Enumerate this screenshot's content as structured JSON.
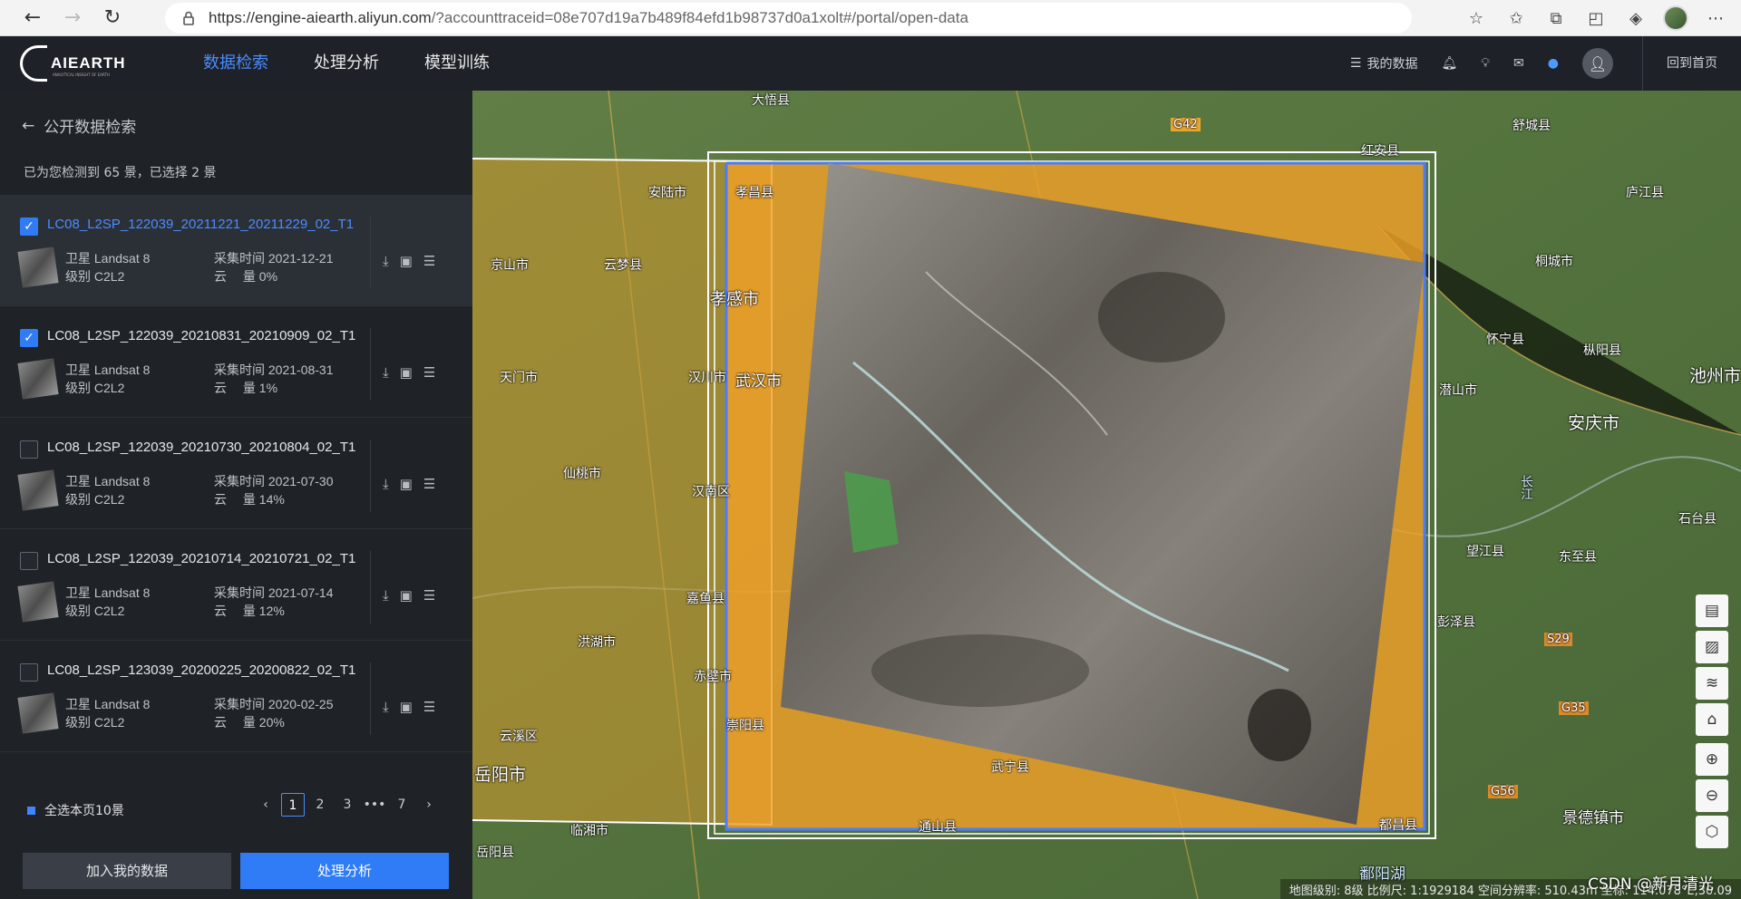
{
  "browser": {
    "url_main": "https://engine-aiearth.aliyun.com",
    "url_rest": "/?accounttraceid=08e707d19a7b489f84efd1b98737d0a1xolt#/portal/open-data"
  },
  "header": {
    "logo_text": "AIEARTH",
    "logo_sub": "ANALYTICAL INSIGHT OF EARTH",
    "nav": [
      "数据检索",
      "处理分析",
      "模型训练"
    ],
    "my_data": "我的数据",
    "back_home": "回到首页"
  },
  "sidebar": {
    "title": "公开数据检索",
    "count_text": "已为您检测到 65 景，已选择 2 景",
    "items": [
      {
        "name": "LC08_L2SP_122039_20211221_20211229_02_T1",
        "sat": "卫星 Landsat 8",
        "level": "级别 C2L2",
        "time": "采集时间 2021-12-21",
        "cloud": "云　 量 0%",
        "checked": true
      },
      {
        "name": "LC08_L2SP_122039_20210831_20210909_02_T1",
        "sat": "卫星 Landsat 8",
        "level": "级别 C2L2",
        "time": "采集时间 2021-08-31",
        "cloud": "云　 量 1%",
        "checked": true
      },
      {
        "name": "LC08_L2SP_122039_20210730_20210804_02_T1",
        "sat": "卫星 Landsat 8",
        "level": "级别 C2L2",
        "time": "采集时间 2021-07-30",
        "cloud": "云　 量 14%",
        "checked": false
      },
      {
        "name": "LC08_L2SP_122039_20210714_20210721_02_T1",
        "sat": "卫星 Landsat 8",
        "level": "级别 C2L2",
        "time": "采集时间 2021-07-14",
        "cloud": "云　 量 12%",
        "checked": false
      },
      {
        "name": "LC08_L2SP_123039_20200225_20200822_02_T1",
        "sat": "卫星 Landsat 8",
        "level": "级别 C2L2",
        "time": "采集时间 2020-02-25",
        "cloud": "云　 量 20%",
        "checked": false
      }
    ],
    "select_all": "全选本页10景",
    "pages": [
      "1",
      "2",
      "3",
      "•••",
      "7"
    ],
    "add_button": "加入我的数据",
    "process_button": "处理分析"
  },
  "map": {
    "labels": [
      {
        "t": "大悟县"
      },
      {
        "t": "G42"
      },
      {
        "t": "红安县"
      },
      {
        "t": "舒城县"
      },
      {
        "t": "安陆市"
      },
      {
        "t": "孝昌县"
      },
      {
        "t": "庐江县"
      },
      {
        "t": "京山市"
      },
      {
        "t": "云梦县"
      },
      {
        "t": "孝感市"
      },
      {
        "t": "桐城市"
      },
      {
        "t": "怀宁县"
      },
      {
        "t": "枞阳县"
      },
      {
        "t": "天门市"
      },
      {
        "t": "汉川市"
      },
      {
        "t": "武汉市"
      },
      {
        "t": "潜山市"
      },
      {
        "t": "池州市"
      },
      {
        "t": "安庆市"
      },
      {
        "t": "仙桃市"
      },
      {
        "t": "汉南区"
      },
      {
        "t": "长江"
      },
      {
        "t": "石台县"
      },
      {
        "t": "望江县"
      },
      {
        "t": "东至县"
      },
      {
        "t": "嘉鱼县"
      },
      {
        "t": "彭泽县"
      },
      {
        "t": "洪湖市"
      },
      {
        "t": "赤壁市"
      },
      {
        "t": "S29"
      },
      {
        "t": "崇阳县"
      },
      {
        "t": "G35"
      },
      {
        "t": "云溪区"
      },
      {
        "t": "岳阳市"
      },
      {
        "t": "临湘市"
      },
      {
        "t": "通山县"
      },
      {
        "t": "武宁县"
      },
      {
        "t": "都昌县"
      },
      {
        "t": "G56"
      },
      {
        "t": "景德镇市"
      },
      {
        "t": "岳阳县"
      },
      {
        "t": "鄱阳湖"
      }
    ],
    "status": "地图级别: 8级   比例尺: 1:1929184   空间分辨率: 510.43m   坐标: 114.078°E,30.09",
    "watermark": "CSDN @新月清光"
  }
}
